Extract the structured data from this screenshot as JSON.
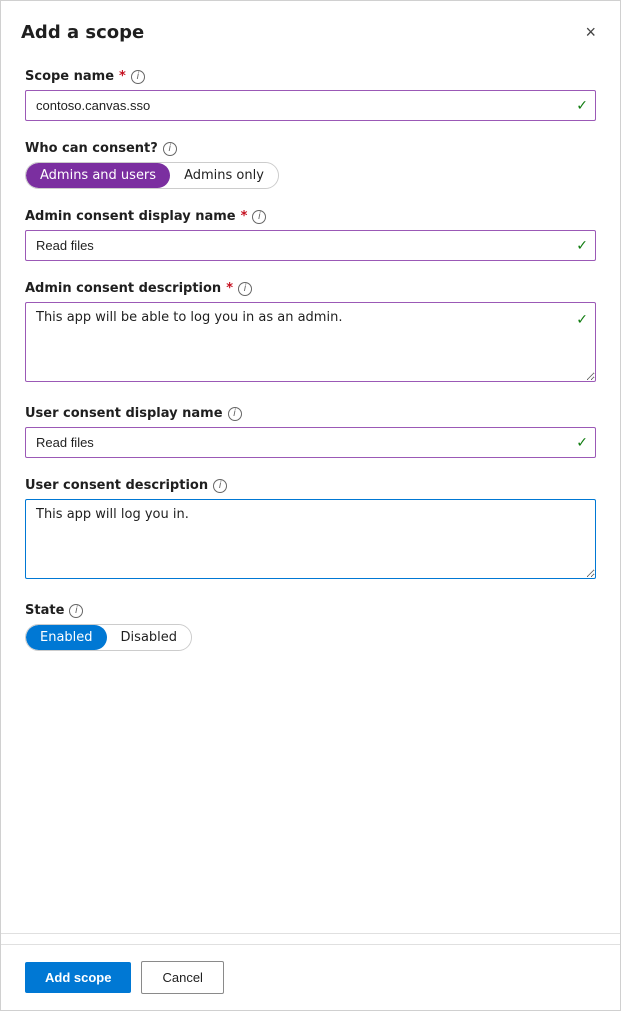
{
  "dialog": {
    "title": "Add a scope",
    "close_label": "×"
  },
  "fields": {
    "scope_name": {
      "label": "Scope name",
      "required": true,
      "value": "contoso.canvas.sso",
      "info": "i"
    },
    "who_can_consent": {
      "label": "Who can consent?",
      "info": "i",
      "options": [
        {
          "label": "Admins and users",
          "active": true,
          "type": "purple"
        },
        {
          "label": "Admins only",
          "active": false
        }
      ]
    },
    "admin_consent_display_name": {
      "label": "Admin consent display name",
      "required": true,
      "value": "Read files",
      "info": "i"
    },
    "admin_consent_description": {
      "label": "Admin consent description",
      "required": true,
      "value": "This app will be able to log you in as an admin.",
      "info": "i"
    },
    "user_consent_display_name": {
      "label": "User consent display name",
      "info": "i",
      "value": "Read files"
    },
    "user_consent_description": {
      "label": "User consent description",
      "info": "i",
      "value": "This app will log you in."
    },
    "state": {
      "label": "State",
      "info": "i",
      "options": [
        {
          "label": "Enabled",
          "active": true,
          "type": "blue"
        },
        {
          "label": "Disabled",
          "active": false
        }
      ]
    }
  },
  "footer": {
    "add_scope": "Add scope",
    "cancel": "Cancel"
  }
}
